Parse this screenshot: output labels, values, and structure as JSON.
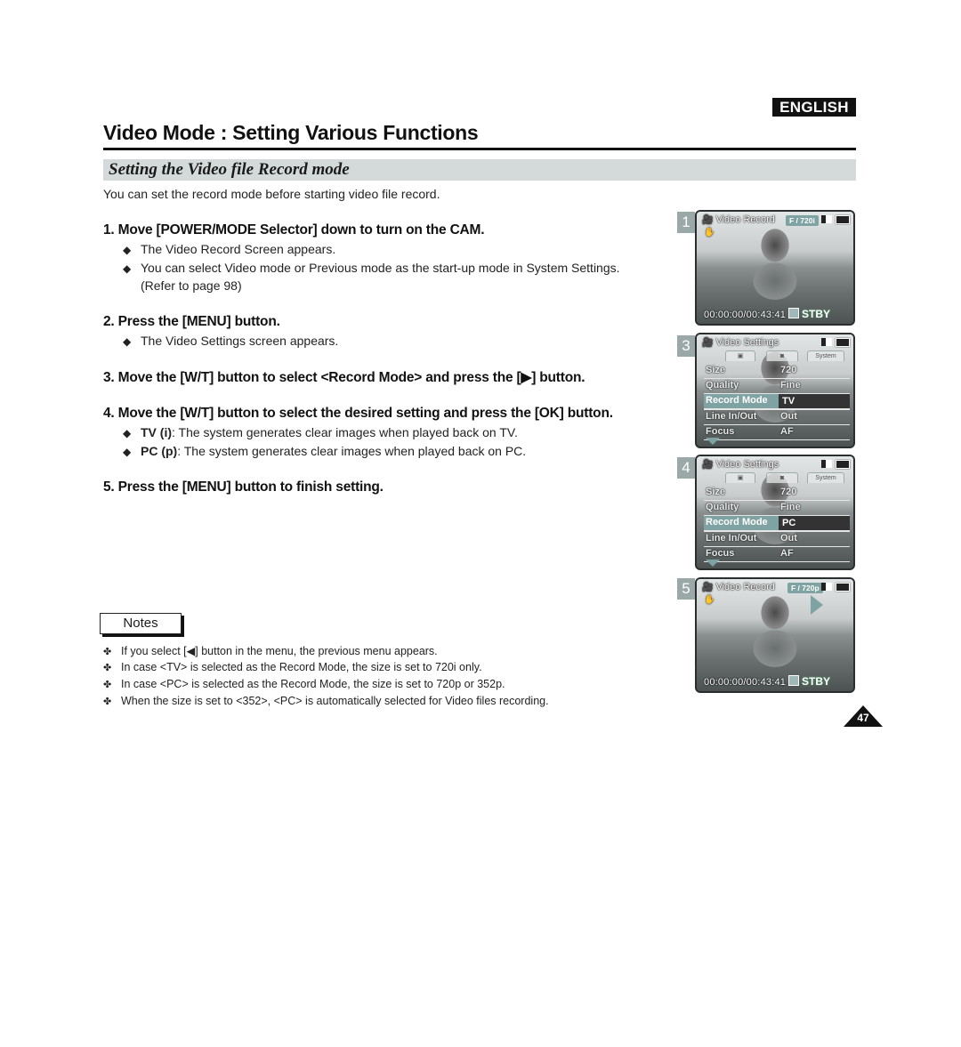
{
  "header": {
    "language_badge": "ENGLISH",
    "page_title": "Video Mode : Setting Various Functions",
    "section_title": "Setting the Video file Record mode",
    "intro": "You can set the record mode before starting video file record."
  },
  "steps": [
    {
      "label": "1. Move [POWER/MODE Selector] down to turn on the CAM.",
      "bullets": [
        {
          "bold": "",
          "text": "The Video Record Screen appears."
        },
        {
          "bold": "",
          "text": "You can select Video mode or Previous mode as the start-up mode in System Settings."
        },
        {
          "bold": "",
          "text": "(Refer to page 98)"
        }
      ]
    },
    {
      "label": "2. Press the [MENU] button.",
      "bullets": [
        {
          "bold": "",
          "text": "The Video Settings screen appears."
        }
      ]
    },
    {
      "label": "3. Move the [W/T] button to select <Record Mode> and press the [▶] button.",
      "bullets": []
    },
    {
      "label": "4. Move the [W/T] button to select the desired setting and press the [OK] button.",
      "bullets": [
        {
          "bold": "TV (i)",
          "text": ": The system generates clear images when played back on TV."
        },
        {
          "bold": "PC (p)",
          "text": ": The system generates clear images when played back on PC."
        }
      ]
    },
    {
      "label": "5. Press the [MENU] button to finish setting.",
      "bullets": []
    }
  ],
  "notes": {
    "title": "Notes",
    "items": [
      "If you select [◀] button in the menu, the previous menu appears.",
      "In case <TV> is selected as the Record Mode, the size is set to 720i only.",
      "In case <PC> is selected as the Record Mode, the size is set to 720p or 352p.",
      "When the size is set to <352>, <PC> is automatically selected for Video files recording."
    ]
  },
  "screens": [
    {
      "number": "1",
      "type": "record",
      "title": "Video Record",
      "quality_tag": "F / 720i",
      "timecode": "00:00:00/00:43:41",
      "status": "STBY"
    },
    {
      "number": "3",
      "type": "settings",
      "title": "Video Settings",
      "tab_system": "System",
      "rows": [
        {
          "label": "Size",
          "value": "720"
        },
        {
          "label": "Quality",
          "value": "Fine"
        },
        {
          "label": "Record Mode",
          "value": "TV",
          "selected": true
        },
        {
          "label": "Line In/Out",
          "value": "Out"
        },
        {
          "label": "Focus",
          "value": "AF"
        }
      ]
    },
    {
      "number": "4",
      "type": "settings",
      "title": "Video Settings",
      "tab_system": "System",
      "rows": [
        {
          "label": "Size",
          "value": "720"
        },
        {
          "label": "Quality",
          "value": "Fine"
        },
        {
          "label": "Record Mode",
          "value": "PC",
          "selected": true
        },
        {
          "label": "Line In/Out",
          "value": "Out"
        },
        {
          "label": "Focus",
          "value": "AF"
        }
      ]
    },
    {
      "number": "5",
      "type": "record",
      "title": "Video Record",
      "quality_tag": "F / 720p",
      "timecode": "00:00:00/00:43:41",
      "status": "STBY"
    }
  ],
  "page_number": "47",
  "colors": {
    "accent_teal": "#7fa3a2",
    "section_bar": "#d4dad9",
    "badge_bg": "#111111"
  }
}
